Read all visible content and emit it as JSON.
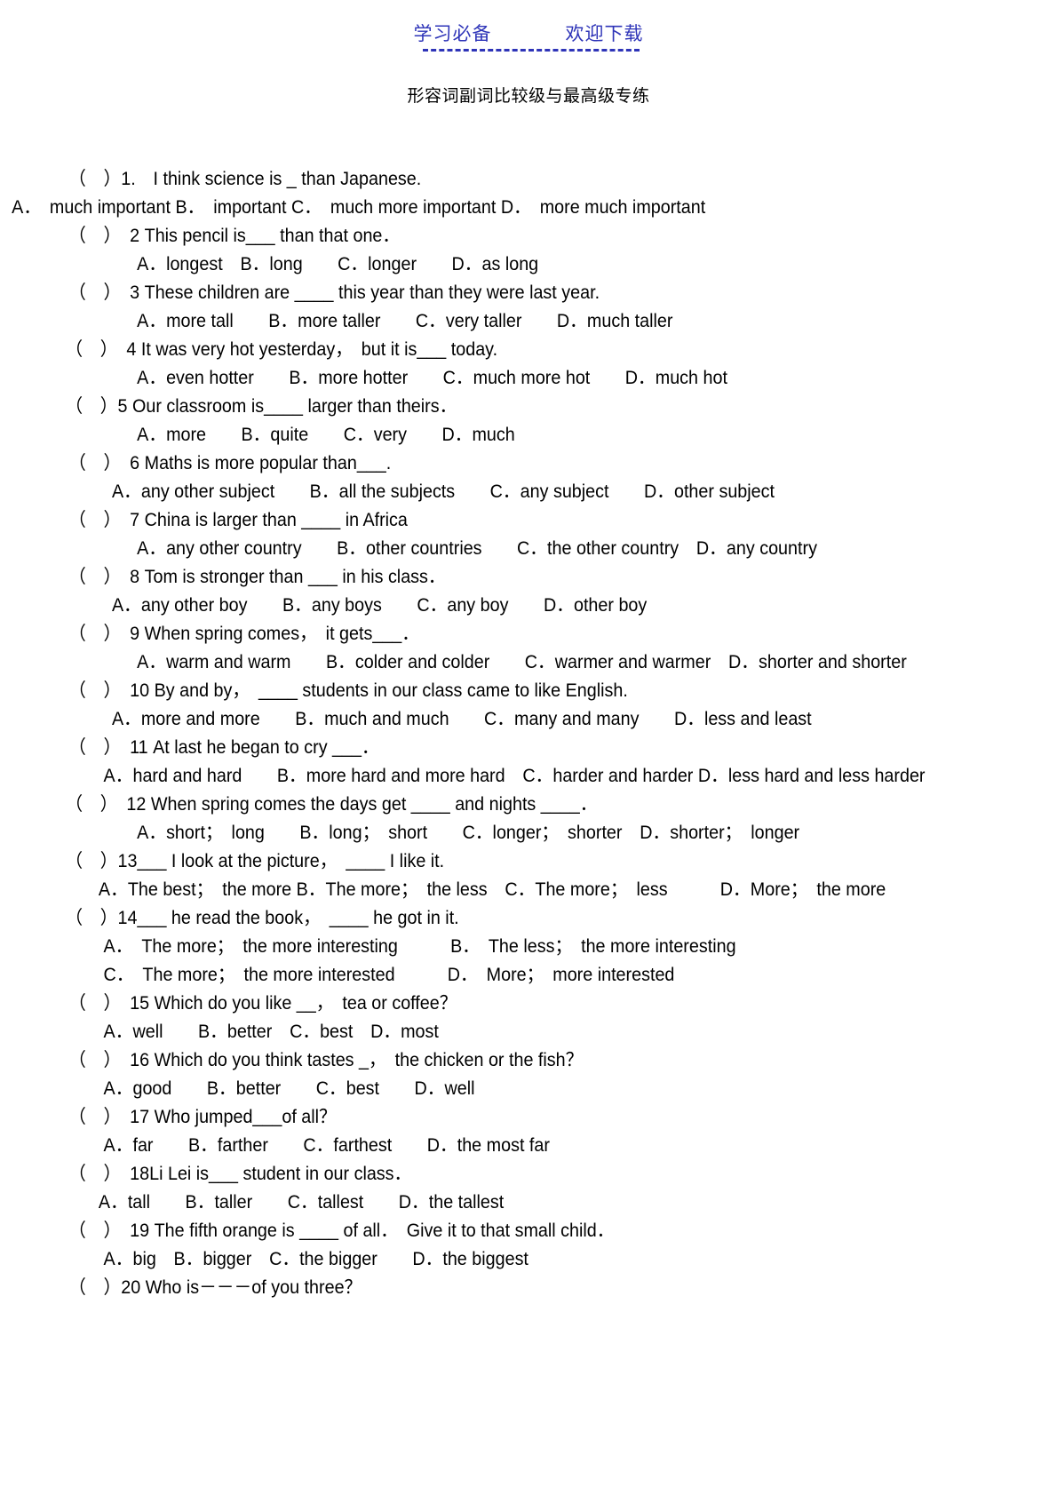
{
  "header": {
    "left_text": "学习必备",
    "right_text": "欢迎下载",
    "rule_color": "#2e34b8",
    "link_color": "#2e34b8"
  },
  "title": "形容词副词比较级与最高级专练",
  "lines": [
    {
      "id": "q1-stem",
      "indent": "i2",
      "text": "（　）1.　I think science is _ than Japanese."
    },
    {
      "id": "q1-options",
      "indent": "i0",
      "text": "A．　much important B．　important C．　much more important D．　more much important"
    },
    {
      "id": "q2-stem",
      "indent": "i2",
      "text": "（　）　2 This pencil is___ than that one．"
    },
    {
      "id": "q2-options",
      "indent": "i8",
      "text": "A．longest　B．long　　C．longer　　D．as long"
    },
    {
      "id": "q3-stem",
      "indent": "i2",
      "text": "（　）　3 These children are ____ this year than they were last year."
    },
    {
      "id": "q3-options",
      "indent": "i8",
      "text": "A．more tall　　B．more taller　　C．very taller　　D．much taller"
    },
    {
      "id": "q4-stem",
      "indent": "i1",
      "text": "（　）　4 It was very hot yesterday，　but it is___ today."
    },
    {
      "id": "q4-options",
      "indent": "i8",
      "text": "A．even hotter　　B．more hotter　　C．much more hot　　D．much hot"
    },
    {
      "id": "q5-stem",
      "indent": "i1",
      "text": "（　）5 Our classroom is____ larger than theirs．"
    },
    {
      "id": "q5-options",
      "indent": "i8",
      "text": "A．more　　B．quite　　C．very　　D．much"
    },
    {
      "id": "q6-stem",
      "indent": "i2",
      "text": "（　）　6 Maths is more popular than___."
    },
    {
      "id": "q6-options",
      "indent": "i7",
      "text": "A．any other subject　　B．all the subjects　　C．any subject　　D．other subject"
    },
    {
      "id": "q7-stem",
      "indent": "i2",
      "text": "（　）　7 China is larger than ____ in Africa"
    },
    {
      "id": "q7-options",
      "indent": "i8",
      "text": "A．any other country　　B．other countries　　C．the other country　D．any country"
    },
    {
      "id": "q8-stem",
      "indent": "i2",
      "text": "（　）　8 Tom is stronger than ___ in his class．"
    },
    {
      "id": "q8-options",
      "indent": "i7",
      "text": "A．any other boy　　B．any boys　　C．any boy　　D．other boy"
    },
    {
      "id": "q9-stem",
      "indent": "i2",
      "text": "（　）　9 When spring comes，　it gets___．"
    },
    {
      "id": "q9-options",
      "indent": "i8",
      "text": "A．warm and warm　　B．colder and colder　　C．warmer and warmer　D．shorter and shorter"
    },
    {
      "id": "q10-stem",
      "indent": "i2",
      "text": "（　）　10 By and by，　____ students in our class came to like English."
    },
    {
      "id": "q10-options",
      "indent": "i7",
      "text": "A．more and more　　B．much and much　　C．many and many　　D．less and least"
    },
    {
      "id": "q11-stem",
      "indent": "i2",
      "text": "（　）　11 At last he began to cry ___．"
    },
    {
      "id": "q11-options",
      "indent": "i6",
      "text": "A．hard and hard　　B．more hard and more hard　C．harder and harder D．less hard and less harder"
    },
    {
      "id": "q12-stem",
      "indent": "i1",
      "text": "（　）　12 When spring comes the days get ____ and nights ____．"
    },
    {
      "id": "q12-options",
      "indent": "i8",
      "text": "A．short；　long　　B．long；　short　　C．longer；　shorter　D．shorter；　longer"
    },
    {
      "id": "q13-stem",
      "indent": "i1",
      "text": "（　）13___ I look at the picture，　____ I like it."
    },
    {
      "id": "q13-options",
      "indent": "i5",
      "text": "A．The best；　the more B．The more；　the less　C．The more；　less　　　D．More；　the more"
    },
    {
      "id": "q14-stem",
      "indent": "i1",
      "text": "（　）14___ he read the book，　____ he got in it."
    },
    {
      "id": "q14-optionsA",
      "indent": "i6",
      "text": "A．　The more；　the more interesting　　　B．　The less；　the more interesting"
    },
    {
      "id": "q14-optionsB",
      "indent": "i6",
      "text": "C．　The more；　the more interested　　　D．　More；　more interested"
    },
    {
      "id": "q15-stem",
      "indent": "i2",
      "text": "（　）　15 Which do you like __，　tea or coffee？"
    },
    {
      "id": "q15-options",
      "indent": "i6",
      "text": "A．well　　B．better　C．best　D．most"
    },
    {
      "id": "q16-stem",
      "indent": "i2",
      "text": "（　）　16 Which do you think tastes _，　the chicken or the fish？"
    },
    {
      "id": "q16-options",
      "indent": "i6",
      "text": "A．good　　B．better　　C．best　　D．well"
    },
    {
      "id": "q17-stem",
      "indent": "i2",
      "text": "（　）　17 Who jumped___of all？"
    },
    {
      "id": "q17-options",
      "indent": "i6",
      "text": "A．far　　B．farther　　C．farthest　　D．the most far"
    },
    {
      "id": "q18-stem",
      "indent": "i2",
      "text": "（　）　18Li Lei is___ student in our class．"
    },
    {
      "id": "q18-options",
      "indent": "i5",
      "text": "A．tall　　B．taller　　C．tallest　　D．the tallest"
    },
    {
      "id": "q19-stem",
      "indent": "i2",
      "text": "（　）　19 The fifth orange is ____ of all．　Give it to that small child．"
    },
    {
      "id": "q19-options",
      "indent": "i6",
      "text": "A．big　B．bigger　C．the bigger　　D．the biggest"
    },
    {
      "id": "q20-stem",
      "indent": "i2",
      "text": "（　）20 Who is－－－of you three？"
    }
  ]
}
